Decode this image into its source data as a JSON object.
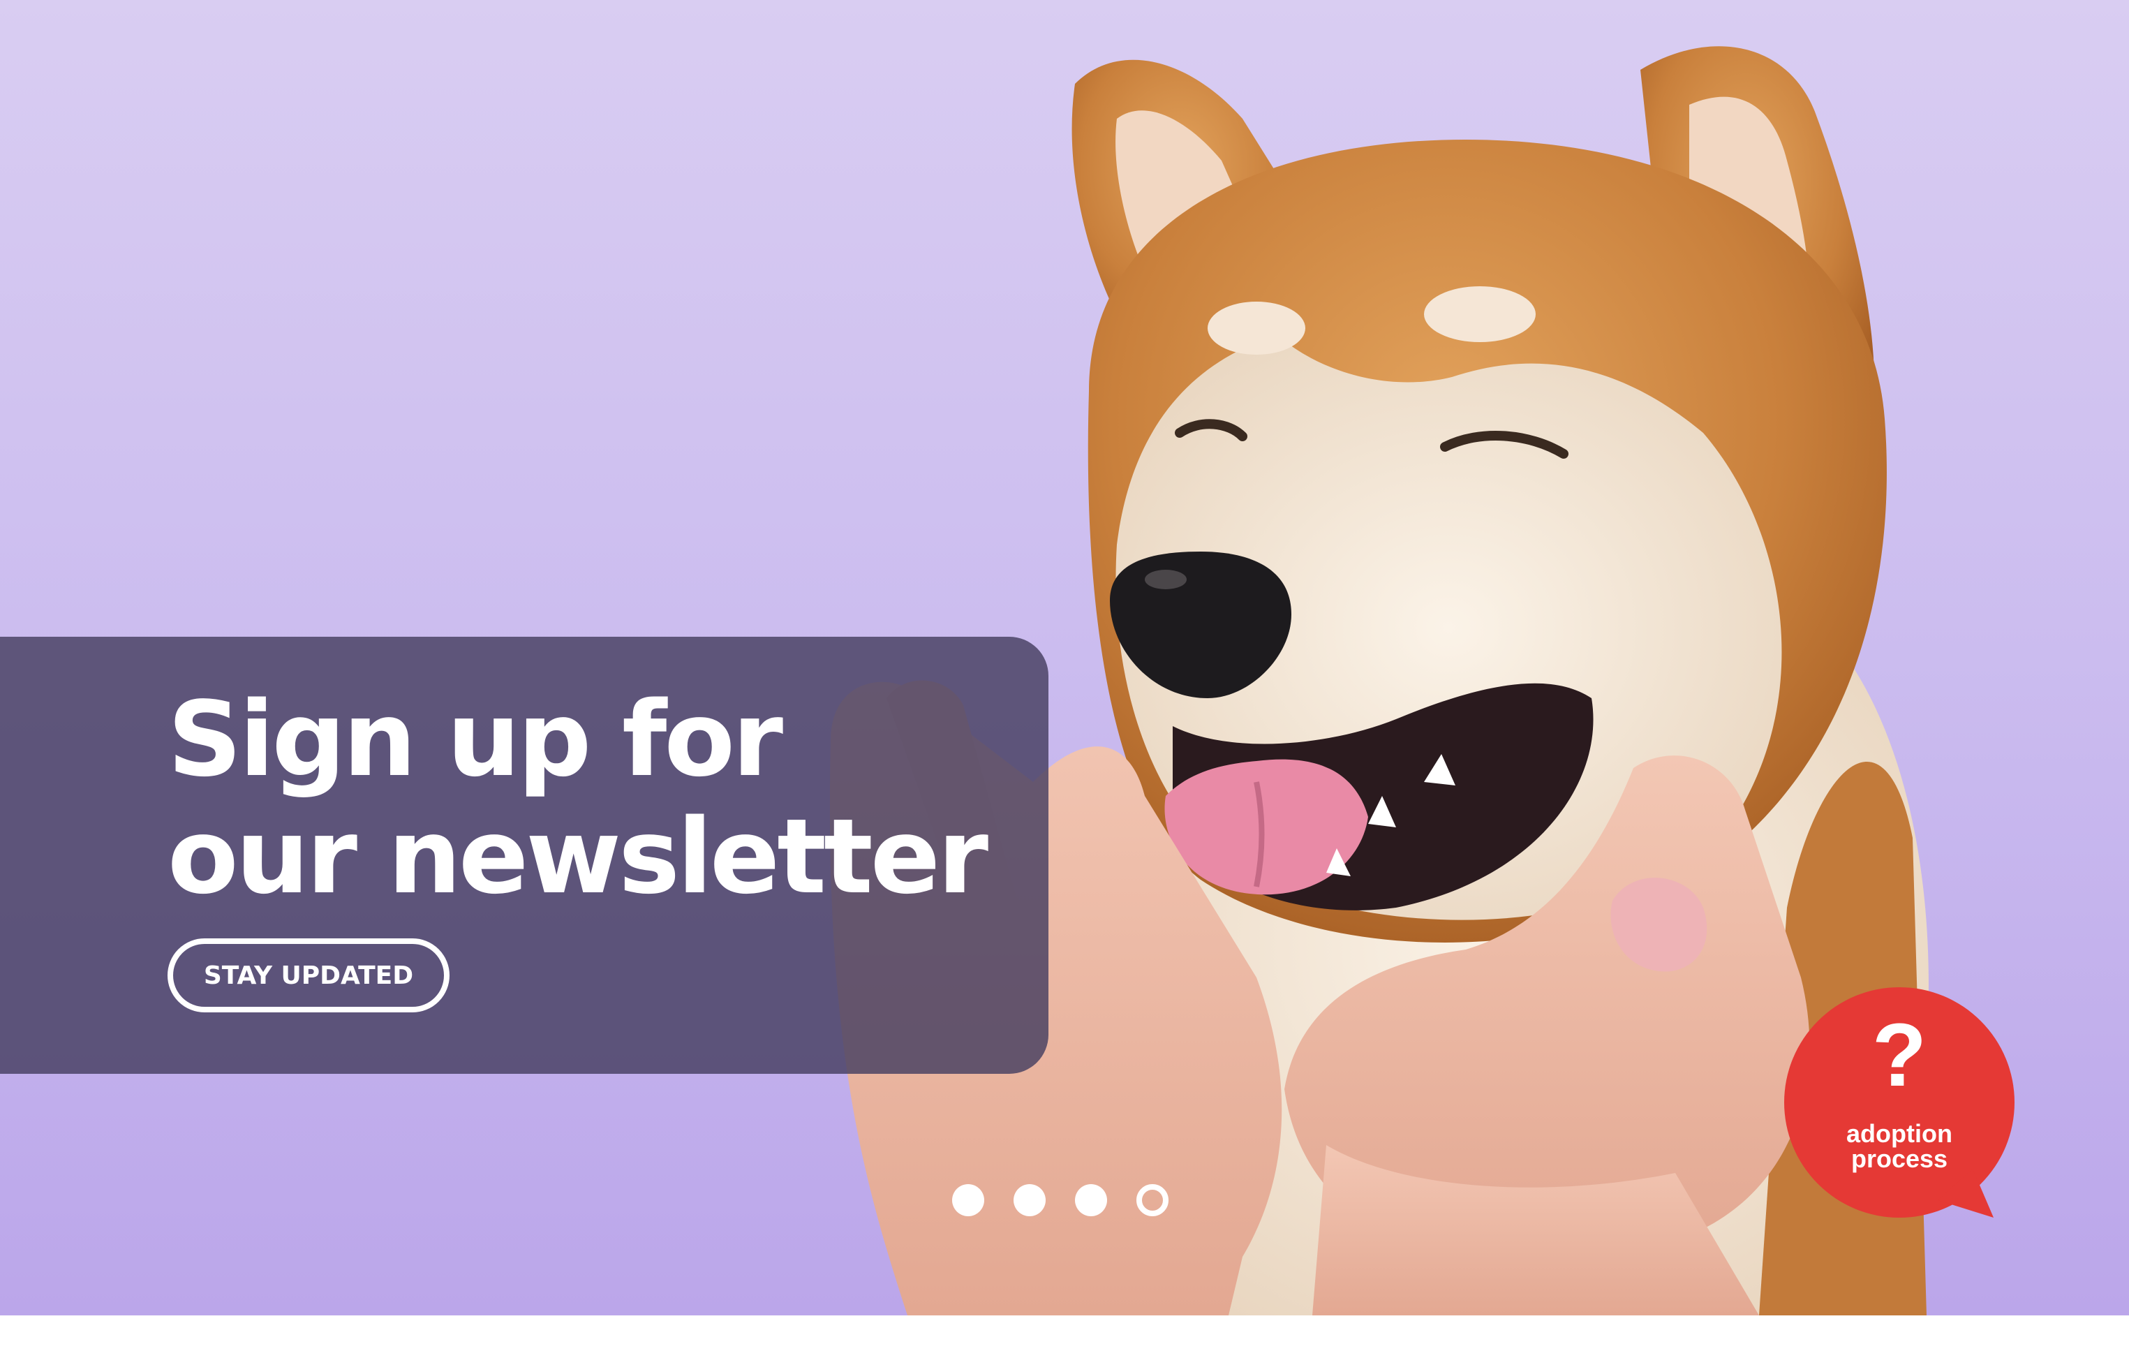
{
  "hero": {
    "image": "shiba-inu-dog-photo",
    "background_color": "#cbbcef"
  },
  "banner": {
    "headline_line1": "Sign up for",
    "headline_line2": "our newsletter",
    "cta_label": "STAY UPDATED",
    "overlay_color": "#463e60"
  },
  "carousel": {
    "dots": [
      {
        "active": false
      },
      {
        "active": false
      },
      {
        "active": false
      },
      {
        "active": true
      }
    ],
    "active_index": 3
  },
  "help": {
    "icon": "question-mark-icon",
    "symbol": "?",
    "label_line1": "adoption",
    "label_line2": "process",
    "color": "#e53935"
  }
}
